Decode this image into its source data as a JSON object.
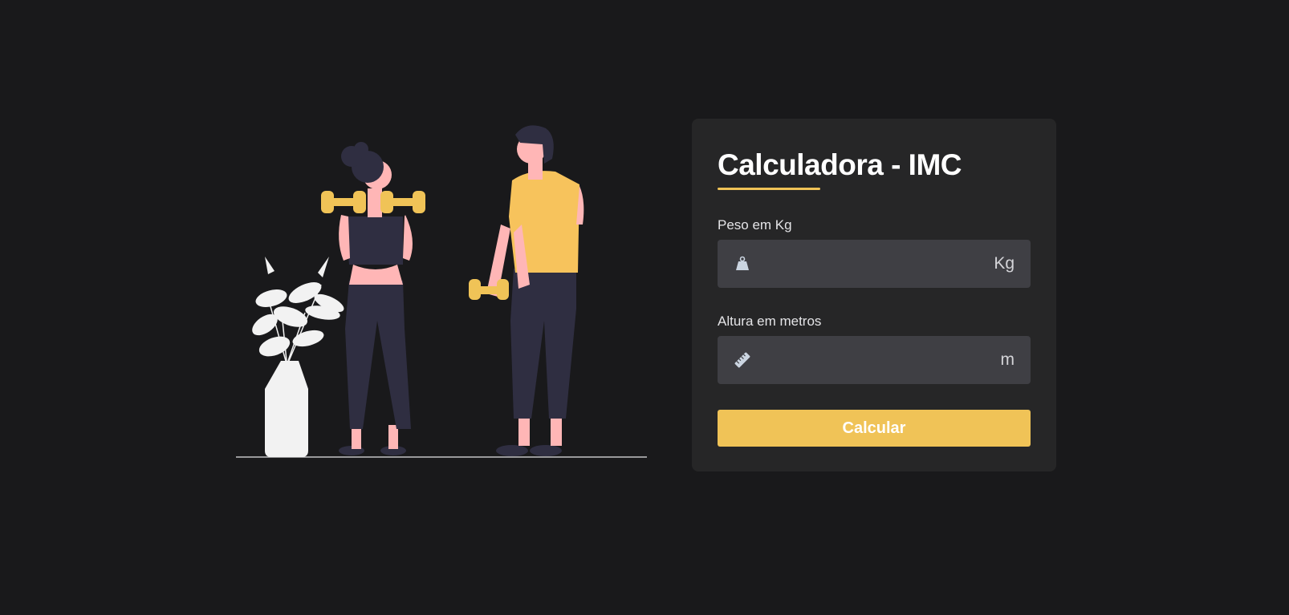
{
  "form": {
    "title": "Calculadora - IMC",
    "weight": {
      "label": "Peso em Kg",
      "value": "",
      "placeholder": "",
      "unit": "Kg",
      "icon": "weight-icon"
    },
    "height": {
      "label": "Altura em metros",
      "value": "",
      "placeholder": "",
      "unit": "m",
      "icon": "ruler-icon"
    },
    "submit_label": "Calcular"
  },
  "colors": {
    "background": "#19191b",
    "card": "#262627",
    "input": "#3f3f44",
    "accent": "#f0c357",
    "skin": "#ffb6b6",
    "dark_figure": "#2f2e41",
    "plant": "#f2f2f2"
  }
}
